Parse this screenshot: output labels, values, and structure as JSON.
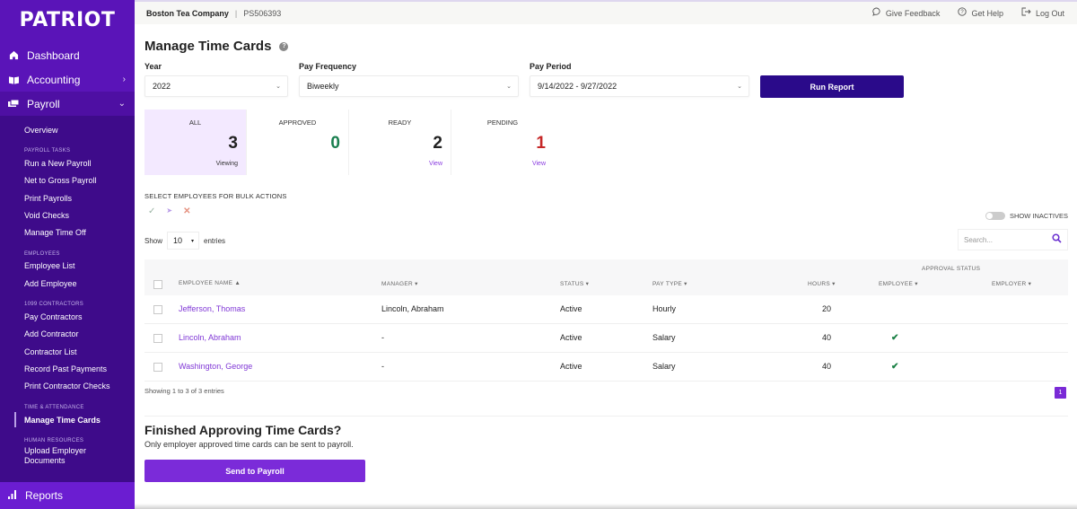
{
  "sidebar": {
    "logo": "PATRIOT",
    "main_items": [
      {
        "label": "Dashboard",
        "icon": "home-icon"
      },
      {
        "label": "Accounting",
        "icon": "book-icon"
      },
      {
        "label": "Payroll",
        "icon": "money-icon"
      }
    ],
    "payroll_overview": "Overview",
    "sections": [
      {
        "heading": "PAYROLL TASKS",
        "items": [
          "Run a New Payroll",
          "Net to Gross Payroll",
          "Print Payrolls",
          "Void Checks",
          "Manage Time Off"
        ]
      },
      {
        "heading": "EMPLOYEES",
        "items": [
          "Employee List",
          "Add Employee"
        ]
      },
      {
        "heading": "1099 CONTRACTORS",
        "items": [
          "Pay Contractors",
          "Add Contractor",
          "Contractor List",
          "Record Past Payments",
          "Print Contractor Checks"
        ]
      },
      {
        "heading": "TIME & ATTENDANCE",
        "items": [
          "Manage Time Cards"
        ]
      },
      {
        "heading": "HUMAN RESOURCES",
        "items": [
          "Upload Employer Documents"
        ]
      }
    ],
    "active_item": "Manage Time Cards",
    "reports": "Reports"
  },
  "topbar": {
    "company": "Boston Tea Company",
    "separator": "|",
    "account_id": "PS506393",
    "actions": [
      {
        "label": "Give Feedback",
        "icon": "chat-bubble-icon"
      },
      {
        "label": "Get Help",
        "icon": "help-circle-icon"
      },
      {
        "label": "Log Out",
        "icon": "logout-icon"
      }
    ]
  },
  "page": {
    "title": "Manage Time Cards",
    "help_icon": "?"
  },
  "filters": {
    "year_label": "Year",
    "year_value": "2022",
    "frequency_label": "Pay Frequency",
    "frequency_value": "Biweekly",
    "period_label": "Pay Period",
    "period_value": "9/14/2022 - 9/27/2022",
    "run_button": "Run Report"
  },
  "summary_cards": [
    {
      "title": "ALL",
      "count": "3",
      "link": "Viewing",
      "color": "#222222"
    },
    {
      "title": "APPROVED",
      "count": "0",
      "link": "",
      "color": "#1a7f4f"
    },
    {
      "title": "READY",
      "count": "2",
      "link": "View",
      "color": "#222222"
    },
    {
      "title": "PENDING",
      "count": "1",
      "link": "View",
      "color": "#c62828"
    }
  ],
  "bulk": {
    "label": "SELECT EMPLOYEES FOR BULK ACTIONS",
    "approve_icon": "✓",
    "send_icon": "➤",
    "reject_icon": "✕"
  },
  "table_controls": {
    "show_label": "Show",
    "entries_value": "10",
    "entries_label": "entries",
    "show_inactives": "SHOW INACTIVES",
    "search_placeholder": "Search..."
  },
  "table": {
    "approval_group": "APPROVAL STATUS",
    "columns": [
      "EMPLOYEE NAME ▲",
      "MANAGER ▾",
      "STATUS ▾",
      "PAY TYPE ▾",
      "HOURS ▾",
      "EMPLOYEE ▾",
      "EMPLOYER ▾"
    ],
    "rows": [
      {
        "name": "Jefferson, Thomas",
        "manager": "Lincoln, Abraham",
        "status": "Active",
        "pay_type": "Hourly",
        "hours": "20",
        "employee_approved": "",
        "employer_approved": ""
      },
      {
        "name": "Lincoln, Abraham",
        "manager": "-",
        "status": "Active",
        "pay_type": "Salary",
        "hours": "40",
        "employee_approved": "✔",
        "employer_approved": ""
      },
      {
        "name": "Washington, George",
        "manager": "-",
        "status": "Active",
        "pay_type": "Salary",
        "hours": "40",
        "employee_approved": "✔",
        "employer_approved": ""
      }
    ],
    "showing": "Showing 1 to 3 of 3 entries",
    "current_page": "1"
  },
  "finish": {
    "title": "Finished Approving Time Cards?",
    "subtitle": "Only employer approved time cards can be sent to payroll.",
    "button": "Send to Payroll"
  }
}
